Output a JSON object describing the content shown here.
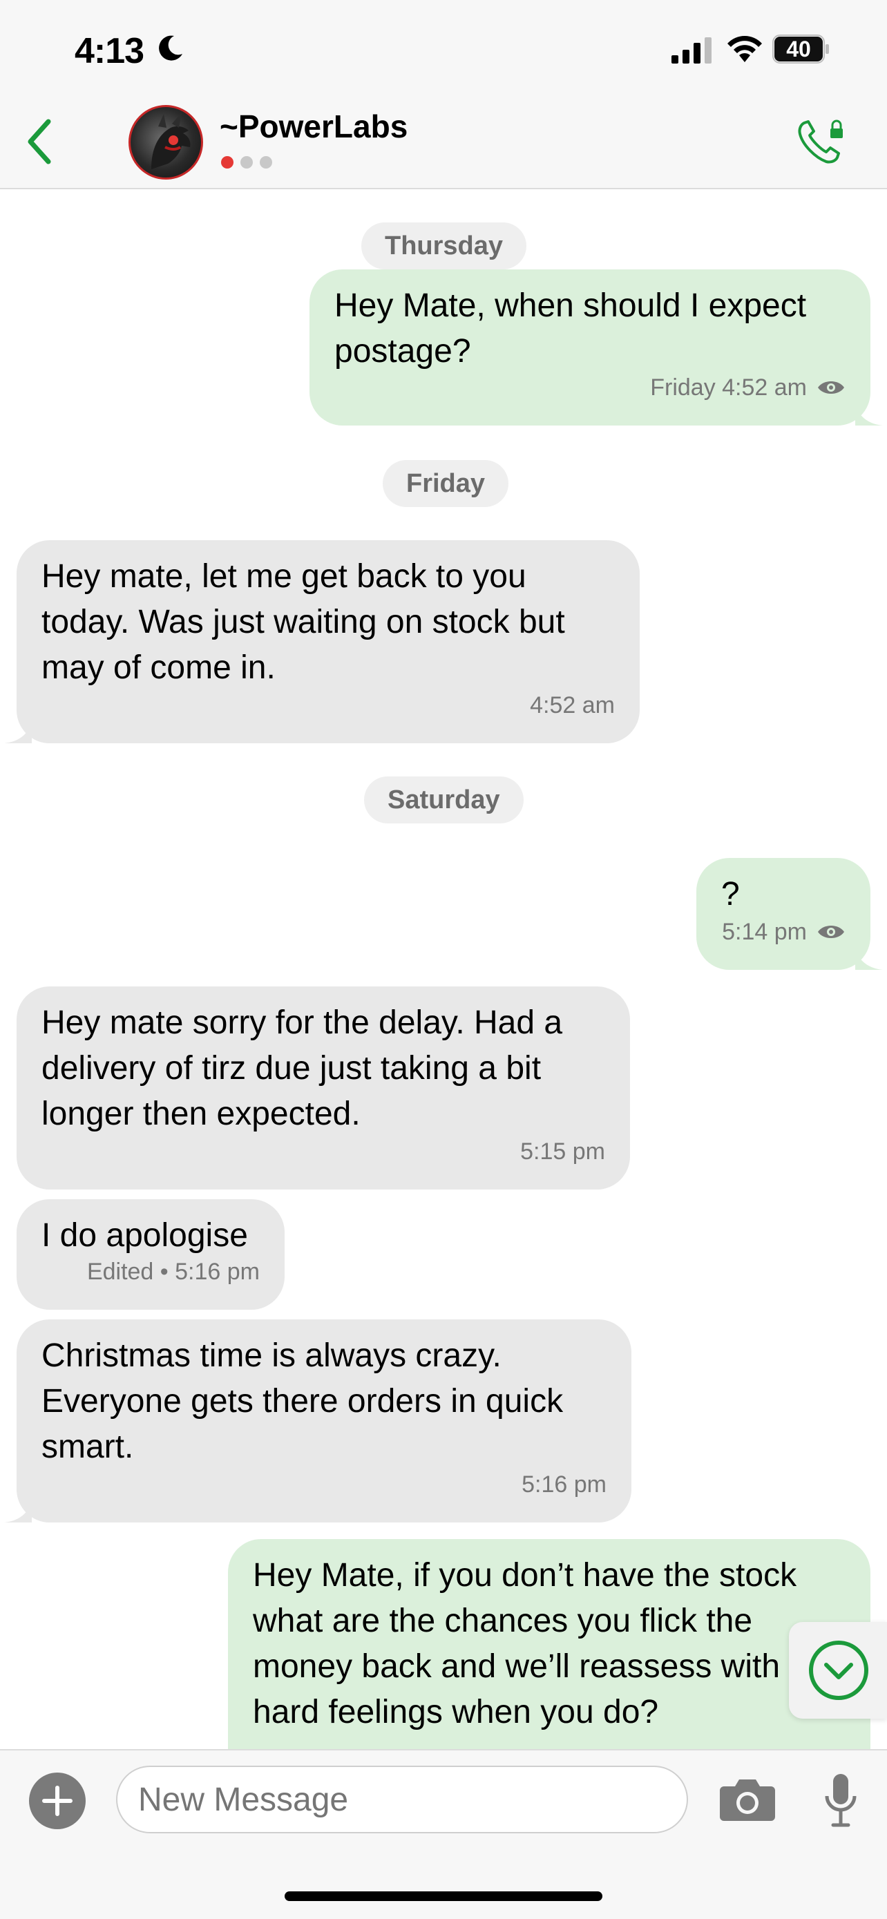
{
  "status_bar": {
    "time": "4:13",
    "battery": "40"
  },
  "header": {
    "contact_name": "~PowerLabs"
  },
  "messages": [
    {
      "type": "date",
      "text": "Thursday"
    },
    {
      "type": "out",
      "text": "Hey Mate, when should I expect postage?",
      "meta": "Friday 4:52 am",
      "seen": true
    },
    {
      "type": "date",
      "text": "Friday"
    },
    {
      "type": "in",
      "text": "Hey mate, let me get back to you today. Was just waiting on stock but may of come in.",
      "meta": "4:52 am"
    },
    {
      "type": "date",
      "text": "Saturday"
    },
    {
      "type": "out",
      "text": "?",
      "meta": "5:14 pm",
      "seen": true
    },
    {
      "type": "in",
      "text": "Hey mate sorry for the delay. Had a delivery of tirz due just taking a bit longer then expected.",
      "meta": "5:15 pm"
    },
    {
      "type": "in",
      "text": "I do apologise",
      "meta": "Edited • 5:16 pm"
    },
    {
      "type": "in",
      "text": "Christmas time is always crazy. Everyone gets there orders in quick smart.",
      "meta": "5:16 pm"
    },
    {
      "type": "out",
      "text": "Hey Mate, if you don’t have the stock what are the chances you flick the money back and we’ll reassess with no hard feelings when you do?"
    }
  ],
  "compose": {
    "placeholder": "New Message"
  },
  "colors": {
    "accent": "#1b9a3b",
    "incoming_bubble": "#e8e8e8",
    "outgoing_bubble": "#dbf0db"
  }
}
